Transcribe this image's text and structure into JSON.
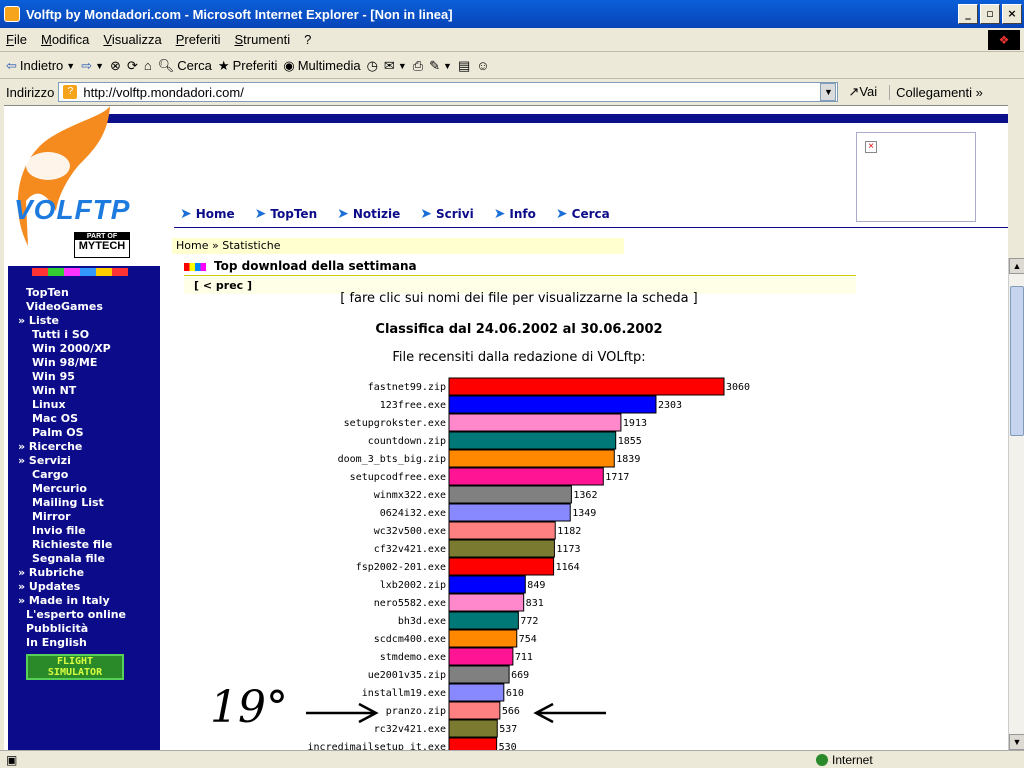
{
  "window": {
    "title": "Volftp by Mondadori.com - Microsoft Internet Explorer - [Non in linea]"
  },
  "menu": [
    "File",
    "Modifica",
    "Visualizza",
    "Preferiti",
    "Strumenti",
    "?"
  ],
  "toolbar": {
    "back": "Indietro",
    "search": "Cerca",
    "favorites": "Preferiti",
    "media": "Multimedia"
  },
  "address": {
    "label": "Indirizzo",
    "url": "http://volftp.mondadori.com/",
    "go": "Vai",
    "links": "Collegamenti"
  },
  "site": {
    "brand": "VOLFTP",
    "partof": "PART OF",
    "mytech": "MYTECH",
    "nav": [
      "Home",
      "TopTen",
      "Notizie",
      "Scrivi",
      "Info",
      "Cerca"
    ],
    "breadcrumb": "Home » Statistiche",
    "section_title": "Top download della settimana",
    "prev": "[ < prec ]",
    "hint": "[ fare clic sui nomi dei file per visualizzarne la scheda ]",
    "ranking": "Classifica dal 24.06.2002 al 30.06.2002",
    "subtitle": "File recensiti dalla redazione di VOLftp:",
    "flight": "FLIGHT SIMULATOR"
  },
  "sidebar": [
    "TopTen",
    "VideoGames",
    "» Liste",
    "Tutti i SO",
    "Win 2000/XP",
    "Win 98/ME",
    "Win 95",
    "Win NT",
    "Linux",
    "Mac OS",
    "Palm OS",
    "» Ricerche",
    "» Servizi",
    "Cargo",
    "Mercurio",
    "Mailing List",
    "Mirror",
    "Invio file",
    "Richieste file",
    "Segnala file",
    "» Rubriche",
    "» Updates",
    "» Made in Italy",
    "L'esperto online",
    "Pubblicità",
    "In English"
  ],
  "annotation": {
    "text": "19°"
  },
  "statusbar": {
    "zone": "Internet"
  },
  "colors": {
    "sidebar": "#0c0c8a",
    "titlebar": "#0844b8"
  },
  "chart_data": {
    "type": "bar",
    "orientation": "horizontal",
    "categories": [
      "fastnet99.zip",
      "123free.exe",
      "setupgrokster.exe",
      "countdown.zip",
      "doom_3_bts_big.zip",
      "setupcodfree.exe",
      "winmx322.exe",
      "0624i32.exe",
      "wc32v500.exe",
      "cf32v421.exe",
      "fsp2002-201.exe",
      "lxb2002.zip",
      "nero5582.exe",
      "bh3d.exe",
      "scdcm400.exe",
      "stmdemo.exe",
      "ue2001v35.zip",
      "installm19.exe",
      "pranzo.zip",
      "rc32v421.exe",
      "incredimailsetup_it.exe"
    ],
    "values": [
      3060,
      2303,
      1913,
      1855,
      1839,
      1717,
      1362,
      1349,
      1182,
      1173,
      1164,
      849,
      831,
      772,
      754,
      711,
      669,
      610,
      566,
      537,
      530
    ],
    "colors": [
      "#ff0000",
      "#0000ff",
      "#ff88cc",
      "#007878",
      "#ff8800",
      "#ff1493",
      "#808080",
      "#8888ff",
      "#ff8080",
      "#7a7a30",
      "#ff0000",
      "#0000ff",
      "#ff88cc",
      "#007878",
      "#ff8800",
      "#ff1493",
      "#808080",
      "#8888ff",
      "#ff8080",
      "#7a7a30",
      "#ff0000"
    ]
  }
}
